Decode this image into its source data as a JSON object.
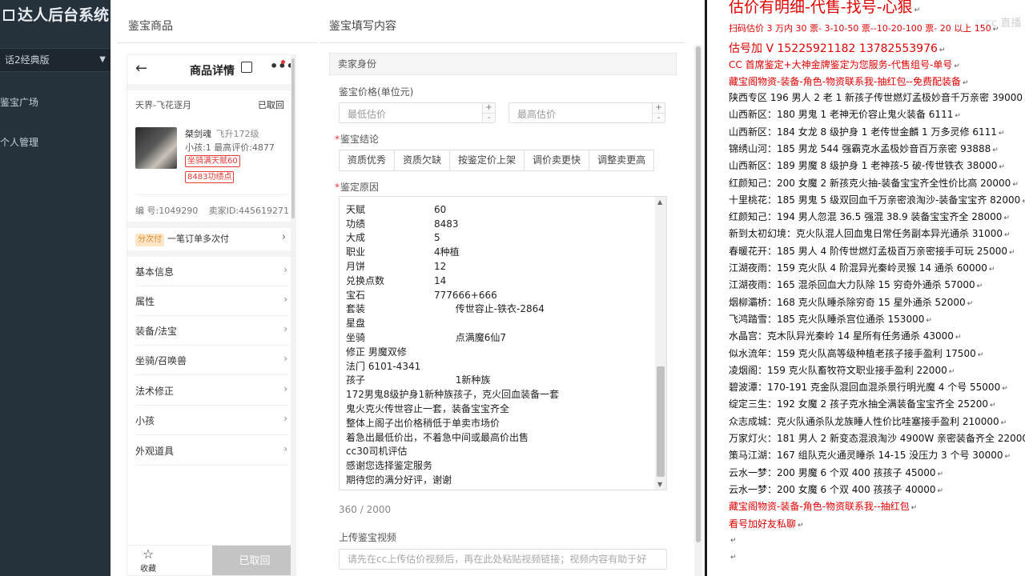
{
  "sidebar": {
    "brand": "达人后台系统",
    "select_value": "话2经典版",
    "items": [
      "鉴宝广场",
      "个人管理"
    ]
  },
  "modal": {
    "close_symbol": "×",
    "left_title": "鉴宝商品",
    "right_title": "鉴宝填写内容"
  },
  "phone": {
    "back": "←",
    "title": "商品详情",
    "more": "•••",
    "region": "天界-飞花逐月",
    "status": "已取回",
    "role_name": "桀剑魂",
    "role_level": "飞升172级",
    "stats": "小孩:1 最高评价:4877",
    "tag1": "坐骑满天赋60",
    "tag2": "8483功绩点",
    "serial": "编 号:1049290",
    "seller_id": "卖家ID:445619271",
    "installment_badge": "分次付",
    "installment_text": "一笔订单多次付",
    "menu": [
      "基本信息",
      "属性",
      "装备/法宝",
      "坐骑/召唤兽",
      "法术修正",
      "小孩",
      "外观道具"
    ],
    "fav_label": "收藏",
    "fav_icon": "☆",
    "canceled_label": "已取回"
  },
  "form": {
    "section_title": "卖家身份",
    "price_label": "鉴宝价格(单位元)",
    "min_placeholder": "最低估价",
    "max_placeholder": "最高估价",
    "conclusion_label": "鉴宝结论",
    "conclusion_buttons": [
      "资质优秀",
      "资质欠缺",
      "按鉴定价上架",
      "调价卖更快",
      "调整卖更高"
    ],
    "reason_label": "鉴定原因",
    "reason_lines": [
      {
        "k": "",
        "v": ""
      },
      {
        "k": "天赋",
        "v": "60"
      },
      {
        "k": "功绩",
        "v": "8483"
      },
      {
        "k": "大成",
        "v": "5"
      },
      {
        "k": "职业",
        "v": "4种植"
      },
      {
        "k": "月饼",
        "v": "12"
      },
      {
        "k": "兑换点数",
        "v": "14"
      },
      {
        "k": "宝石",
        "v": "777666+666"
      },
      {
        "k": "套装",
        "v": "       传世容止-铁衣-2864"
      },
      {
        "k": "星盘",
        "v": ""
      },
      {
        "k": "坐骑",
        "v": "       点满魔6仙7"
      },
      {
        "k": "",
        "v": "修正 男魔双修"
      },
      {
        "k": "",
        "v": "法门 6101-4341"
      },
      {
        "k": "孩子",
        "v": "       1新种族"
      },
      {
        "k": "",
        "v": "172男鬼8级护身1新种族孩子，克火回血装备一套"
      },
      {
        "k": "",
        "v": "鬼火克火传世容止一套，装备宝宝齐全"
      },
      {
        "k": "",
        "v": "整体上阁子出价格稍低于单卖市场价"
      },
      {
        "k": "",
        "v": "着急出最低价出，不着急中间或最高价出售"
      },
      {
        "k": "",
        "v": "cc30司机评估"
      },
      {
        "k": "",
        "v": "感谢您选择鉴定服务"
      },
      {
        "k": "",
        "v": "期待您的满分好评，谢谢"
      }
    ],
    "counter": "360 / 2000",
    "video_label": "上传鉴宝视频",
    "video_placeholder": "请先在cc上传估价视频后，再在此处粘贴视频链接；视频内容有助于好"
  },
  "ad": {
    "watermark": "cc 直播",
    "lines": [
      {
        "text": "估价有明细-代售-找号-心狠",
        "style": "red big"
      },
      {
        "text": "扫码估价 3 万内 30 票- 3-10-50 票--10-20-100 票- 20 以上 150",
        "style": "red sm"
      },
      {
        "text": "估号加 V 15225921182   13782553976",
        "style": "red mid"
      },
      {
        "text": "CC 首席鉴定+大神金牌鉴定为您服务-代售组号-单号",
        "style": "red"
      },
      {
        "text": "藏宝阁物资-装备-角色-物资联系我-抽红包--免费配装备",
        "style": "red"
      },
      {
        "text": "陕西专区 196 男人 2 老 1 新孩子传世燃灯孟极妙音千万亲密 39000",
        "style": ""
      },
      {
        "text": "山西新区：180 男鬼 1 老神无价容止鬼火装备 6111",
        "style": ""
      },
      {
        "text": "山西新区：184 女龙 8 级护身 1 老传世金麟 1 万多灵修 6111",
        "style": ""
      },
      {
        "text": "锦绣山河：185 男龙 544 强霸克水孟极妙音百万亲密 93888",
        "style": ""
      },
      {
        "text": "山西新区：189 男魔 8 级护身 1 老神孩-5 破-传世铁衣 38000",
        "style": ""
      },
      {
        "text": "红颜知己：200 女魔 2 新孩克火抽-装备宝宝齐全性价比高 20000",
        "style": ""
      },
      {
        "text": "十里桃花：185 男鬼 5 级双回血千万亲密浪淘沙-装备宝宝齐 82000",
        "style": ""
      },
      {
        "text": "红颜知己：194 男人忽混 36.5 强混 38.9 装备宝宝齐全 28000",
        "style": ""
      },
      {
        "text": "新到太初幻境：克火队混人回血鬼日常任务副本异光通杀 31000",
        "style": ""
      },
      {
        "text": "春暖花开：185 男人 4 阶传世燃灯孟极百万亲密接手可玩 25000",
        "style": ""
      },
      {
        "text": "江湖夜雨：159 克火队 4 阶混异光秦岭灵猴 14 通杀 60000",
        "style": ""
      },
      {
        "text": "江湖夜雨：165 混杀回血大力队除 15 穷奇外通杀 57000",
        "style": ""
      },
      {
        "text": "烟柳灞桥：168 克火队睡杀除穷奇 15 星外通杀 52000",
        "style": ""
      },
      {
        "text": "飞鸿踏雪：185 克火队睡杀宫位通杀 153000",
        "style": ""
      },
      {
        "text": "水晶宫：克木队异光秦岭 14 星所有任务通杀 43000",
        "style": ""
      },
      {
        "text": "似水流年：159 克火队高等级种植老孩子接手盈利 17500",
        "style": ""
      },
      {
        "text": "凌烟阁：159 克火队畜牧符文职业接手盈利 22000",
        "style": ""
      },
      {
        "text": "碧波潭：170-191 克金队混回血混杀景行明光魔 4 个号 55000",
        "style": ""
      },
      {
        "text": "绽定三生：192 女魔 2 孩子克水抽全满装备宝宝齐全 25200",
        "style": ""
      },
      {
        "text": "众志成城：克火队通杀队龙族睡人性价比哇塞接手盈利 210000",
        "style": ""
      },
      {
        "text": "万家灯火：181 男人 2 新变态混浪淘沙 4900W 亲密装备齐全 220000",
        "style": ""
      },
      {
        "text": "策马江湖：167 组队克火通灵睡杀 14-15 没压力 3 个号 30000",
        "style": ""
      },
      {
        "text": "云水一梦：200 男魔 6 个双 400 孩孩子 45000",
        "style": ""
      },
      {
        "text": "云水一梦：200 女魔 6 个双 400 孩孩子 40000",
        "style": ""
      },
      {
        "text": "藏宝阁物资-装备-角色-物资联系我--抽红包",
        "style": "red"
      },
      {
        "text": "看号加好友私聊",
        "style": "red"
      },
      {
        "text": "",
        "style": ""
      },
      {
        "text": "",
        "style": ""
      }
    ]
  }
}
